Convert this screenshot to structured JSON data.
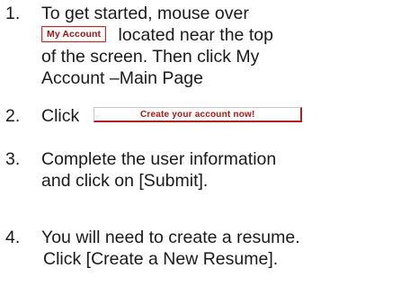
{
  "steps": [
    {
      "number": "1.",
      "line1": "To get started, mouse over",
      "button_label": "My Account",
      "line2_after_button": "located near the top",
      "line3": "of the screen. Then click My",
      "line4": "Account –Main Page"
    },
    {
      "number": "2.",
      "label": "Click",
      "button_label": "Create your account now!"
    },
    {
      "number": "3.",
      "line1": "Complete the user information",
      "line2": "and click on [Submit]."
    },
    {
      "number": "4.",
      "line1": "You will need to create a resume.",
      "line2": "Click [Create a New Resume]."
    }
  ],
  "colors": {
    "button_text": "#a01212",
    "button_border": "#b23030",
    "body_text": "#1a1a1a"
  }
}
